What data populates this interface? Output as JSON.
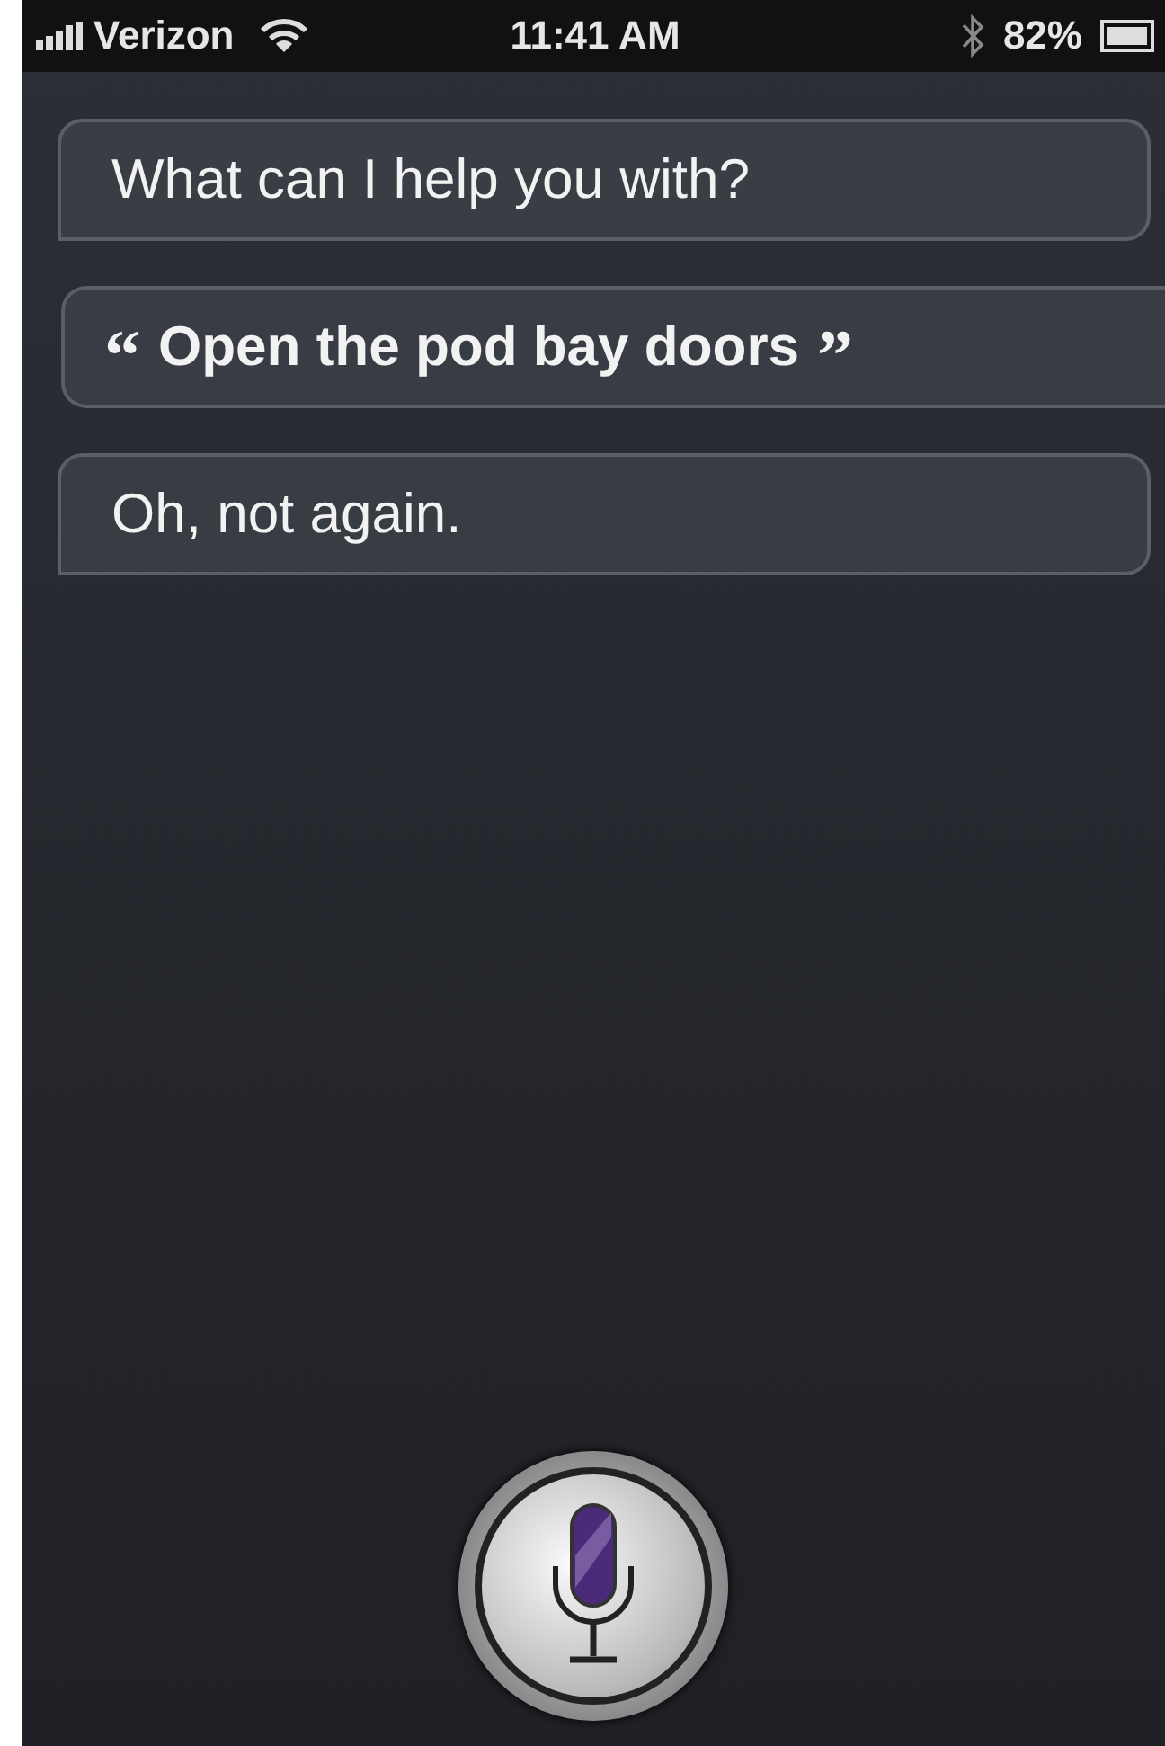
{
  "status_bar": {
    "carrier": "Verizon",
    "time": "11:41 AM",
    "battery": "82%"
  },
  "messages": [
    {
      "kind": "siri",
      "text": "What can I help you with?"
    },
    {
      "kind": "user",
      "open_quote": "“",
      "text": "Open the pod bay doors",
      "close_quote": "”"
    },
    {
      "kind": "siri",
      "text": "Oh, not again."
    }
  ]
}
